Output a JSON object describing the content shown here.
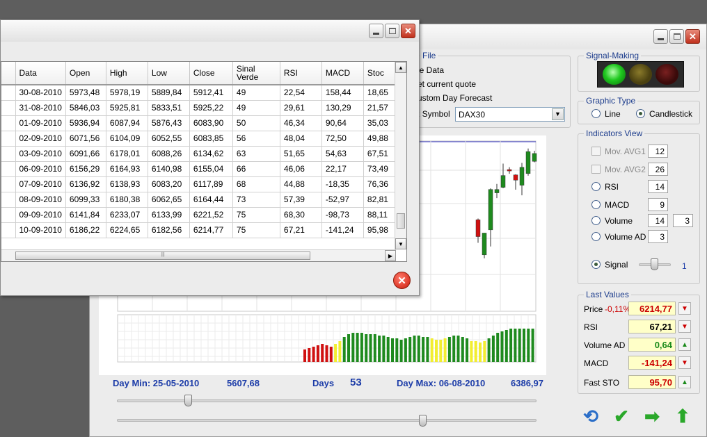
{
  "file_group": {
    "title": "File",
    "items": [
      "le Data",
      "et current quote",
      "ustom Day Forecast"
    ],
    "symbol_label": "t Symbol",
    "symbol_value": "DAX30"
  },
  "signal_group": {
    "title": "Signal-Making"
  },
  "graphic_type": {
    "title": "Graphic Type",
    "line_label": "Line",
    "candle_label": "Candlestick",
    "selected": "Candlestick"
  },
  "indicators": {
    "title": "Indicators View",
    "mov_avg1": {
      "label": "Mov. AVG1",
      "value": "12"
    },
    "mov_avg2": {
      "label": "Mov. AVG2",
      "value": "26"
    },
    "rsi": {
      "label": "RSI",
      "value": "14"
    },
    "macd": {
      "label": "MACD",
      "value": "9"
    },
    "volume": {
      "label": "Volume",
      "value": "14",
      "value2": "3"
    },
    "volume_ad": {
      "label": "Volume AD",
      "value": "3"
    },
    "signal": {
      "label": "Signal",
      "value": "1"
    }
  },
  "last_values": {
    "title": "Last Values",
    "change_pct": "-0,11%",
    "rows": [
      {
        "label": "Price",
        "value": "6214,77",
        "trend": "down",
        "color": "#cc0000"
      },
      {
        "label": "RSI",
        "value": "67,21",
        "trend": "down",
        "color": "#000000"
      },
      {
        "label": "Volume AD",
        "value": "0,64",
        "trend": "up",
        "color": "#1a8a1a"
      },
      {
        "label": "MACD",
        "value": "-141,24",
        "trend": "down",
        "color": "#cc0000"
      },
      {
        "label": "Fast STO",
        "value": "95,70",
        "trend": "up",
        "color": "#cc0000"
      }
    ]
  },
  "stats": {
    "day_min": "Day Min: 25-05-2010",
    "day_min_value": "5607,68",
    "days_label": "Days",
    "days_value": "53",
    "day_max": "Day Max: 06-08-2010",
    "day_max_value": "6386,97"
  },
  "sliders": {
    "range_start": 0.17,
    "range_end": 0.73
  },
  "data_table": {
    "headers": [
      "Data",
      "Open",
      "High",
      "Low",
      "Close",
      "Sinal Verde",
      "RSI",
      "MACD",
      "Stoc"
    ],
    "rows": [
      [
        "30-08-2010",
        "5973,48",
        "5978,19",
        "5889,84",
        "5912,41",
        "49",
        "22,54",
        "158,44",
        "18,65"
      ],
      [
        "31-08-2010",
        "5846,03",
        "5925,81",
        "5833,51",
        "5925,22",
        "49",
        "29,61",
        "130,29",
        "21,57"
      ],
      [
        "01-09-2010",
        "5936,94",
        "6087,94",
        "5876,43",
        "6083,90",
        "50",
        "46,34",
        "90,64",
        "35,03"
      ],
      [
        "02-09-2010",
        "6071,56",
        "6104,09",
        "6052,55",
        "6083,85",
        "56",
        "48,04",
        "72,50",
        "49,88"
      ],
      [
        "03-09-2010",
        "6091,66",
        "6178,01",
        "6088,26",
        "6134,62",
        "63",
        "51,65",
        "54,63",
        "67,51"
      ],
      [
        "06-09-2010",
        "6156,29",
        "6164,93",
        "6140,98",
        "6155,04",
        "66",
        "46,06",
        "22,17",
        "73,49"
      ],
      [
        "07-09-2010",
        "6136,92",
        "6138,93",
        "6083,20",
        "6117,89",
        "68",
        "44,88",
        "-18,35",
        "76,36"
      ],
      [
        "08-09-2010",
        "6099,33",
        "6180,38",
        "6062,65",
        "6164,44",
        "73",
        "57,39",
        "-52,97",
        "82,81"
      ],
      [
        "09-09-2010",
        "6141,84",
        "6233,07",
        "6133,99",
        "6221,52",
        "75",
        "68,30",
        "-98,73",
        "88,11"
      ],
      [
        "10-09-2010",
        "6186,22",
        "6224,65",
        "6182,56",
        "6214,77",
        "75",
        "67,21",
        "-141,24",
        "95,98"
      ]
    ]
  },
  "colors": {
    "bull": "#1e8a1e",
    "bear": "#d01010",
    "neutral": "#f2ee30",
    "accent": "#1c3ca8"
  }
}
